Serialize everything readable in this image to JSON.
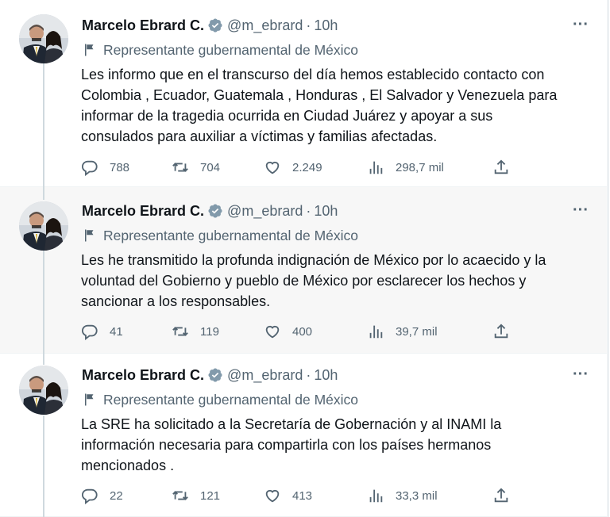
{
  "colors": {
    "text": "#0f1419",
    "secondary": "#536471",
    "verified": "#829aab",
    "hover_background": "#f7f7f7",
    "thread_line": "#cfd9de"
  },
  "tweets": [
    {
      "author": {
        "name": "Marcelo Ebrard C.",
        "handle": "@m_ebrard",
        "time": "10h",
        "separator": "·"
      },
      "affiliation": "Representante gubernamental de México",
      "text": "Les informo que en el transcurso del día hemos establecido contacto con\nColombia , Ecuador, Guatemala , Honduras ,  El Salvador y Venezuela para\ninformar de la tragedia ocurrida en Ciudad Juárez y apoyar a sus\nconsulados para auxiliar a víctimas y familias afectadas.",
      "stats": {
        "replies": "788",
        "retweets": "704",
        "likes": "2.249",
        "views": "298,7 mil"
      }
    },
    {
      "author": {
        "name": "Marcelo Ebrard C.",
        "handle": "@m_ebrard",
        "time": "10h",
        "separator": "·"
      },
      "affiliation": "Representante gubernamental de México",
      "text": "Les he transmitido la profunda indignación de México por lo acaecido y la\nvoluntad del Gobierno y pueblo de México por esclarecer los hechos y\nsancionar a los responsables.",
      "stats": {
        "replies": "41",
        "retweets": "119",
        "likes": "400",
        "views": "39,7 mil"
      }
    },
    {
      "author": {
        "name": "Marcelo Ebrard C.",
        "handle": "@m_ebrard",
        "time": "10h",
        "separator": "·"
      },
      "affiliation": "Representante gubernamental de México",
      "text": "La SRE ha solicitado a la Secretaría de Gobernación y al INAMI la\ninformación necesaria para compartirla con los países hermanos\nmencionados .",
      "stats": {
        "replies": "22",
        "retweets": "121",
        "likes": "413",
        "views": "33,3 mil"
      }
    }
  ],
  "icons": {
    "verified": "verified-badge-icon",
    "affiliation": "flag-icon",
    "more": "more-options-icon",
    "reply": "reply-icon",
    "retweet": "retweet-icon",
    "like": "heart-icon",
    "views": "views-chart-icon",
    "share": "share-icon"
  },
  "more_label": "···"
}
